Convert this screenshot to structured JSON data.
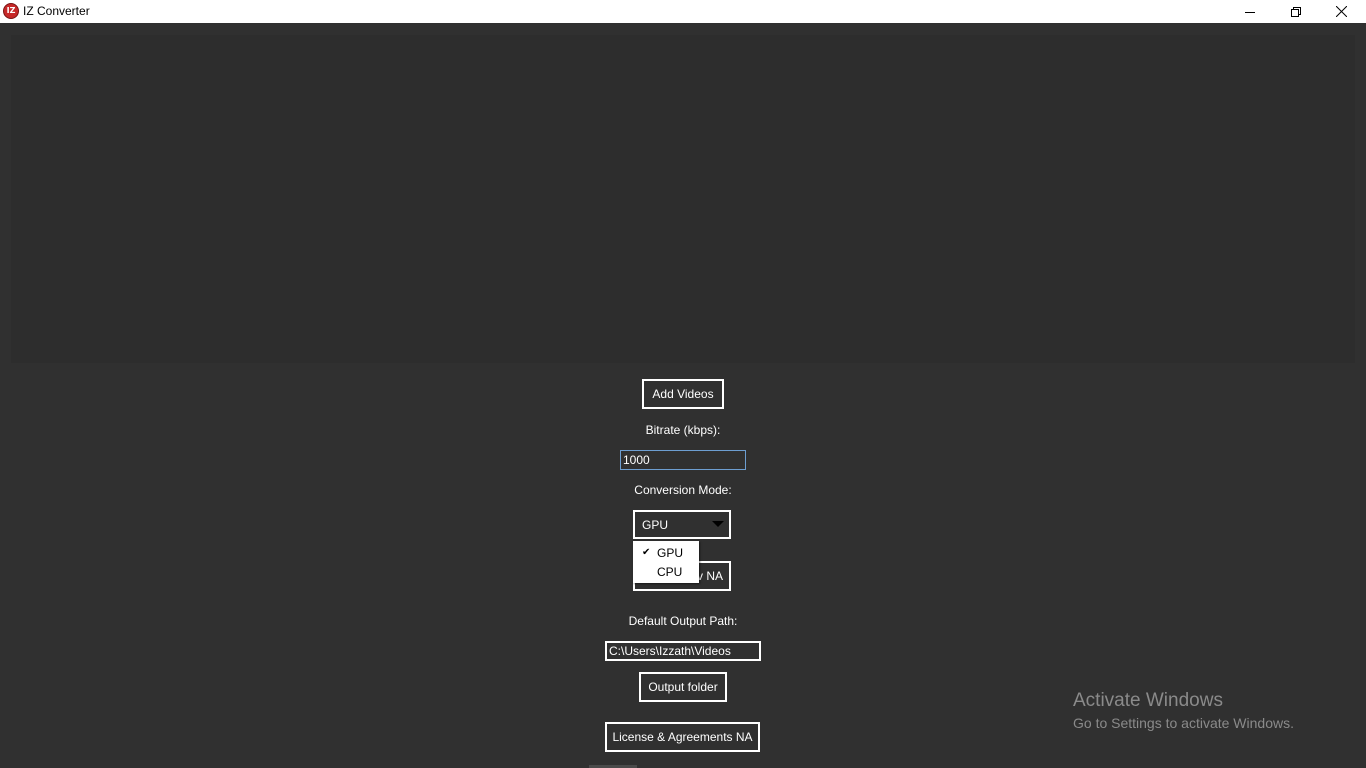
{
  "window": {
    "title": "IZ Converter",
    "icon_text": "IZ"
  },
  "controls": {
    "add_videos": "Add Videos",
    "bitrate_label": "Bitrate (kbps):",
    "bitrate_value": "1000",
    "mode_label": "Conversion Mode:",
    "mode_selected": "GPU",
    "mode_options": [
      "GPU",
      "CPU"
    ],
    "hidden_button_suffix": "v NA",
    "output_path_label": "Default Output Path:",
    "output_path_value": "C:\\Users\\Izzath\\Videos",
    "output_folder": "Output folder",
    "license": "License & Agreements NA"
  },
  "watermark": {
    "title": "Activate Windows",
    "subtitle": "Go to Settings to activate Windows."
  },
  "colors": {
    "background": "#303030",
    "list_area": "#2d2d2d",
    "accent": "#6d9ed1",
    "app_icon": "#c62828"
  }
}
